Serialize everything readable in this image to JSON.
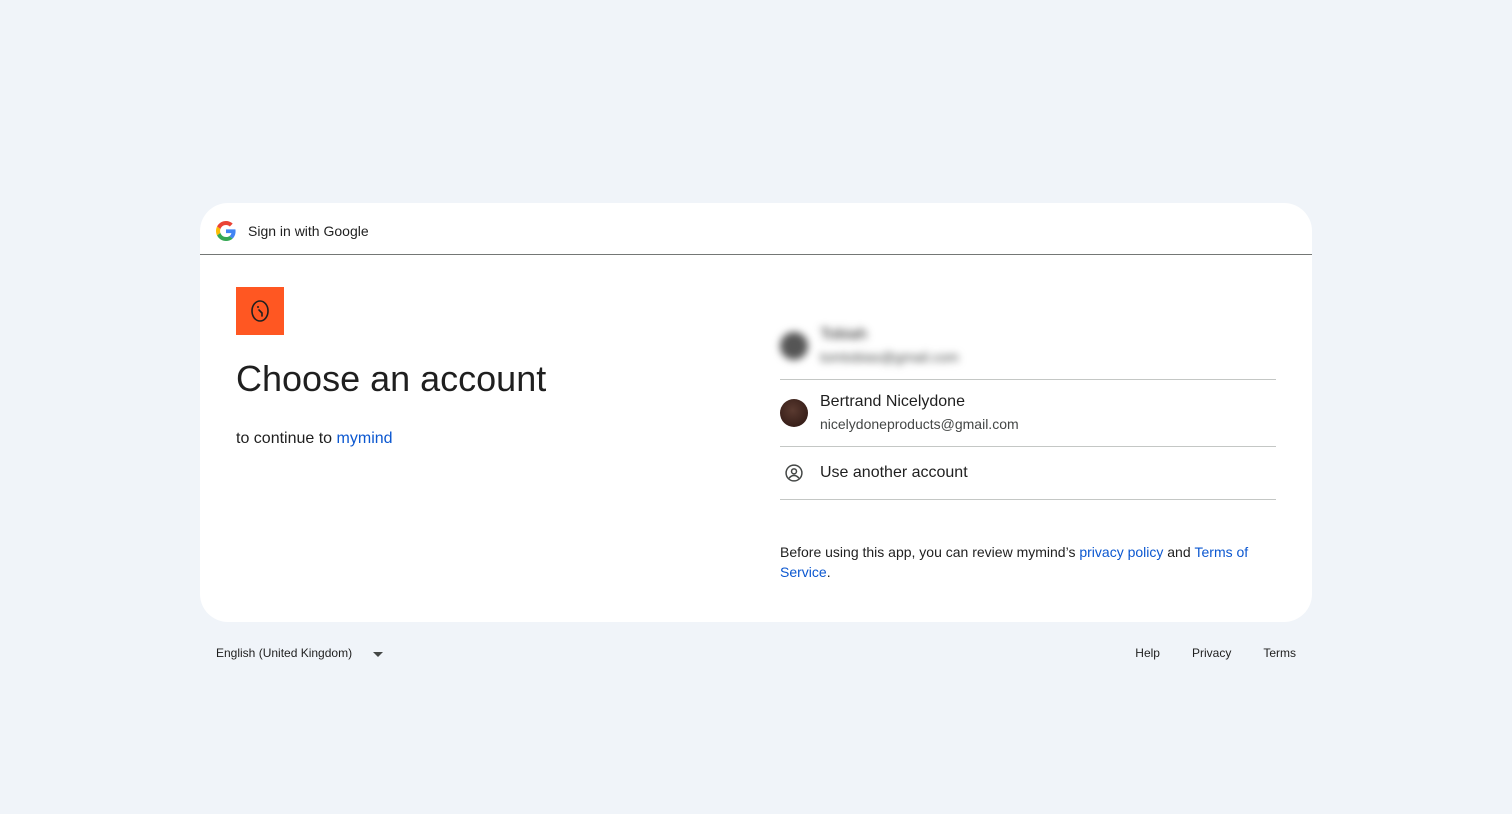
{
  "header": {
    "title": "Sign in with Google",
    "logo_icon": "google-g-icon"
  },
  "app": {
    "logo_icon": "mymind-logo-icon",
    "logo_color": "#ff5722"
  },
  "main": {
    "title": "Choose an account",
    "subtitle_prefix": "to continue to",
    "app_name": "mymind"
  },
  "accounts": [
    {
      "name": "Tobiah",
      "email": "tomtobias@gmail.com",
      "blurred": true
    },
    {
      "name": "Bertrand Nicelydone",
      "email": "nicelydoneproducts@gmail.com",
      "blurred": false
    }
  ],
  "use_another": {
    "label": "Use another account",
    "icon": "account-circle-icon"
  },
  "disclaimer": {
    "prefix": "Before using this app, you can review mymind’s",
    "privacy_link": "privacy policy",
    "and": "and",
    "terms_link": "Terms of Service",
    "suffix": "."
  },
  "footer": {
    "language": "English (United Kingdom)",
    "links": [
      "Help",
      "Privacy",
      "Terms"
    ]
  },
  "colors": {
    "background": "#f0f4f9",
    "link": "#0b57d0",
    "text": "#1f1f1f"
  }
}
